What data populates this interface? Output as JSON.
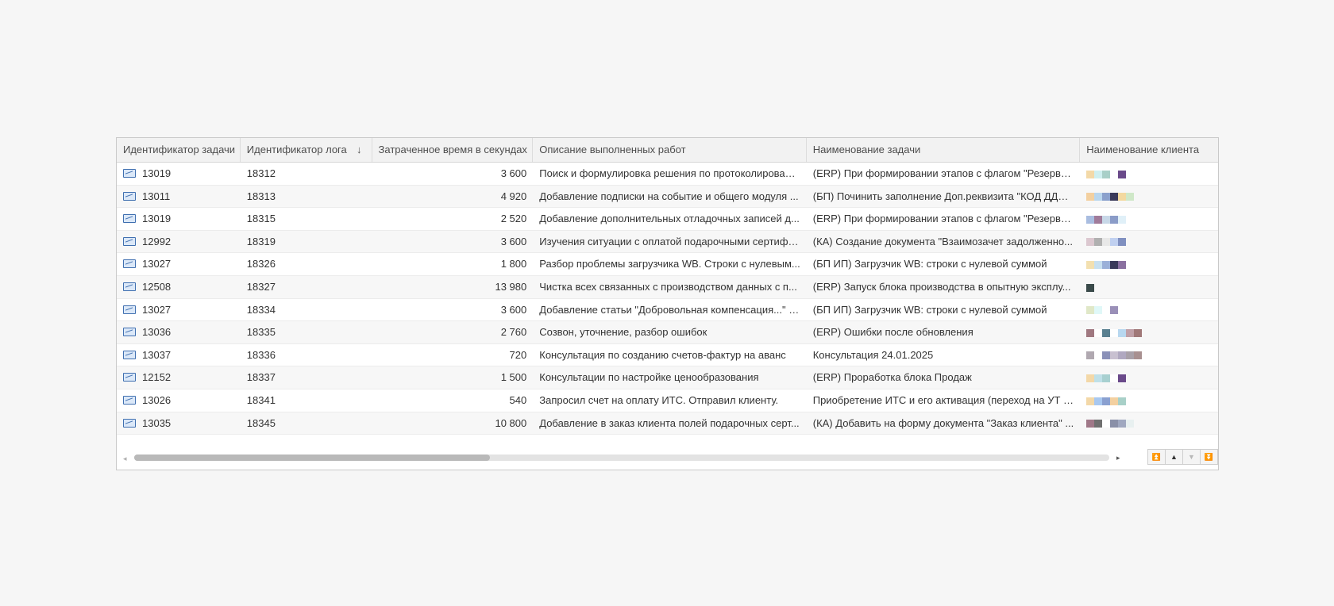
{
  "table": {
    "headers": [
      "Идентификатор задачи",
      "Идентификатор лога",
      "Затраченное время в секундах",
      "Описание выполненных работ",
      "Наименование задачи",
      "Наименование клиента"
    ],
    "sort_indicator": "↓",
    "rows": [
      {
        "task_id": "13019",
        "log_id": "18312",
        "seconds": "3 600",
        "description": "Поиск и формулировка решения по протоколировани...",
        "task_name": "(ERP) При формировании этапов с флагом \"Резерви..."
      },
      {
        "task_id": "13011",
        "log_id": "18313",
        "seconds": "4 920",
        "description": "Добавление подписки на событие и общего модуля ...",
        "task_name": "(БП) Починить заполнение Доп.реквизита \"КОД ДДС..."
      },
      {
        "task_id": "13019",
        "log_id": "18315",
        "seconds": "2 520",
        "description": "Добавление дополнительных отладочных записей д...",
        "task_name": "(ERP) При формировании этапов с флагом \"Резерви..."
      },
      {
        "task_id": "12992",
        "log_id": "18319",
        "seconds": "3 600",
        "description": "Изучения ситуации с оплатой подарочными сертифи...",
        "task_name": "(КА) Создание документа \"Взаимозачет задолженно..."
      },
      {
        "task_id": "13027",
        "log_id": "18326",
        "seconds": "1 800",
        "description": "Разбор проблемы загрузчика WB. Строки с нулевым...",
        "task_name": "(БП ИП) Загрузчик WB: строки с нулевой суммой"
      },
      {
        "task_id": "12508",
        "log_id": "18327",
        "seconds": "13 980",
        "description": "Чистка всех связанных с производством данных с п...",
        "task_name": "(ERP) Запуск блока производства в опытную эксплу..."
      },
      {
        "task_id": "13027",
        "log_id": "18334",
        "seconds": "3 600",
        "description": "Добавление статьи \"Добровольная компенсация...\" в...",
        "task_name": "(БП ИП) Загрузчик WB: строки с нулевой суммой"
      },
      {
        "task_id": "13036",
        "log_id": "18335",
        "seconds": "2 760",
        "description": "Созвон, уточнение, разбор ошибок",
        "task_name": "(ERP) Ошибки после обновления"
      },
      {
        "task_id": "13037",
        "log_id": "18336",
        "seconds": "720",
        "description": "Консультация по созданию счетов-фактур на аванс",
        "task_name": "Консультация 24.01.2025"
      },
      {
        "task_id": "12152",
        "log_id": "18337",
        "seconds": "1 500",
        "description": "Консультации по настройке ценообразования",
        "task_name": "(ERP) Проработка блока Продаж"
      },
      {
        "task_id": "13026",
        "log_id": "18341",
        "seconds": "540",
        "description": "Запросил счет на оплату ИТС. Отправил клиенту.",
        "task_name": "Приобретение ИТС и его активация (переход на УТ 1..."
      },
      {
        "task_id": "13035",
        "log_id": "18345",
        "seconds": "10 800",
        "description": "Добавление в заказ клиента полей подарочных серт...",
        "task_name": "(КА) Добавить на форму документа \"Заказ клиента\" ..."
      }
    ],
    "client_pixel_colors": [
      [
        "#f3d9a8",
        "#cfeff0",
        "#a8cfc8",
        "#ffffff",
        "#6a4a8a"
      ],
      [
        "#f3d0a0",
        "#b9d6ee",
        "#8aa0cc",
        "#3b3a5a",
        "#f3d9a0",
        "#cfe8c8"
      ],
      [
        "#a9bde0",
        "#a07b9a",
        "#c8d8e8",
        "#8a9cc8",
        "#e0f0f8"
      ],
      [
        "#dcc8d0",
        "#b0b0b0",
        "#e8e8e8",
        "#c0d0f0",
        "#8090c0"
      ],
      [
        "#f3e0b0",
        "#c8e0f0",
        "#9ab0d8",
        "#3a3a5a",
        "#8a70a0"
      ],
      [
        "#3a4a4a"
      ],
      [
        "#e0e8c8",
        "#e0f8f8",
        "#ffffff",
        "#9a90b8"
      ],
      [
        "#a07880",
        "#ffffff",
        "#5a8090",
        "#ffffff",
        "#b8d8f0",
        "#c0a0a8",
        "#a07878"
      ],
      [
        "#b0a8b0",
        "#ffffff",
        "#8a90b8",
        "#c8c0d0",
        "#b0a8c0",
        "#a8a0a8",
        "#a89090"
      ],
      [
        "#f3d8a8",
        "#bfe0e8",
        "#a8d0d0",
        "#ffffff",
        "#6a4a8a"
      ],
      [
        "#f3d8a8",
        "#a8c8f0",
        "#8aa0d0",
        "#f3d0a0",
        "#a8d0c8"
      ],
      [
        "#a07888",
        "#707070",
        "#ffffff",
        "#8a90a8",
        "#a0a8c0",
        "#e8f0f0"
      ]
    ],
    "icon": "task-chart-icon"
  },
  "navigation": {
    "buttons": [
      "first-page-icon",
      "page-up-icon",
      "page-down-icon",
      "last-page-icon"
    ]
  },
  "colors": {
    "header_bg": "#f2f2f2",
    "icon_blue": "#3f6fb0",
    "scroll_thumb": "#b9b9b9"
  }
}
